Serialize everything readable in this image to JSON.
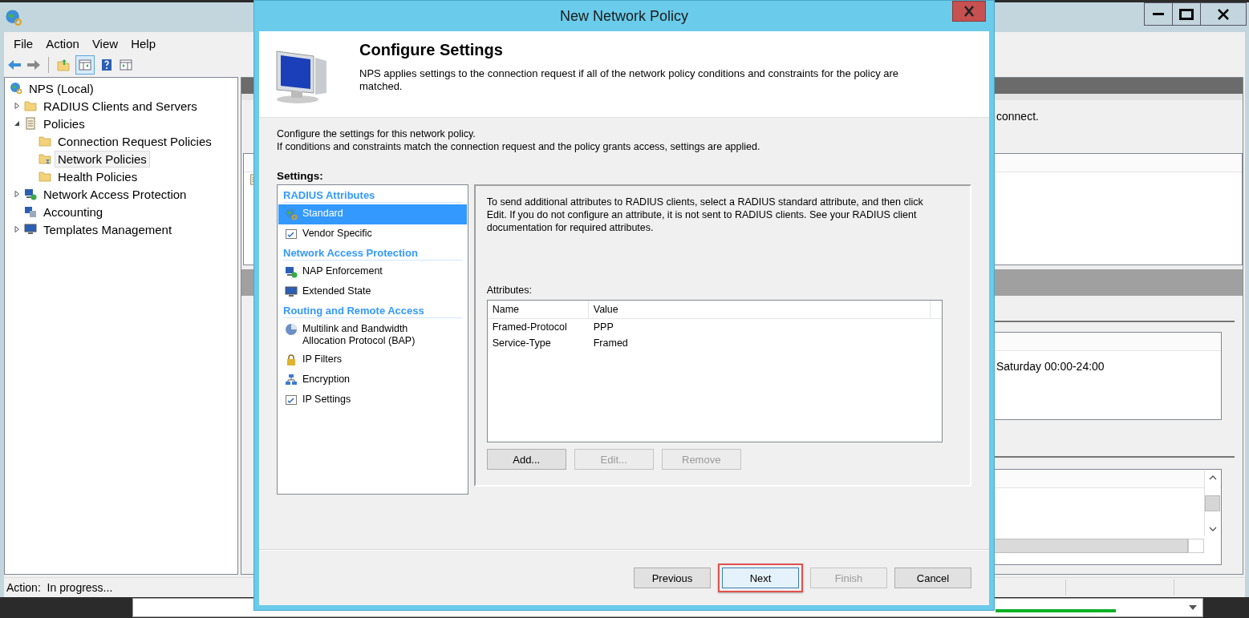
{
  "app": {
    "menu": [
      "File",
      "Action",
      "View",
      "Help"
    ],
    "tree": [
      {
        "label": "NPS (Local)",
        "kind": "globe",
        "selected": false,
        "children": [
          {
            "label": "RADIUS Clients and Servers",
            "kind": "folder",
            "expanded": false,
            "selected": false
          },
          {
            "label": "Policies",
            "kind": "scroll",
            "expanded": true,
            "selected": false,
            "children": [
              {
                "label": "Connection Request Policies",
                "kind": "folder",
                "selected": false
              },
              {
                "label": "Network Policies",
                "kind": "folder-busy",
                "selected": true
              },
              {
                "label": "Health Policies",
                "kind": "folder",
                "selected": false
              }
            ]
          },
          {
            "label": "Network Access Protection",
            "kind": "nap",
            "expanded": false,
            "selected": false
          },
          {
            "label": "Accounting",
            "kind": "accounting",
            "selected": false
          },
          {
            "label": "Templates Management",
            "kind": "monitor",
            "expanded": false,
            "selected": false
          }
        ]
      }
    ],
    "pane": {
      "note": "connect.",
      "schedule": "Saturday 00:00-24:00"
    },
    "status_bar": "Action:  In progress..."
  },
  "dialog": {
    "title": "New Network Policy",
    "heading": "Configure Settings",
    "description": "NPS applies settings to the connection request if all of the network policy conditions and constraints for the policy are matched.",
    "intro": [
      "Configure the settings for this network policy.",
      "If conditions and constraints match the connection request and the policy grants access, settings are applied."
    ],
    "settings_label": "Settings:",
    "settings": [
      {
        "kind": "heading",
        "label": "RADIUS Attributes"
      },
      {
        "kind": "globe",
        "label": "Standard",
        "selected": true
      },
      {
        "kind": "checklist",
        "label": "Vendor Specific",
        "selected": false
      },
      {
        "kind": "heading",
        "label": "Network Access Protection"
      },
      {
        "kind": "nap",
        "label": "NAP Enforcement",
        "selected": false
      },
      {
        "kind": "monitor",
        "label": "Extended State",
        "selected": false
      },
      {
        "kind": "heading",
        "label": "Routing and Remote Access"
      },
      {
        "kind": "pie",
        "label": "Multilink and Bandwidth Allocation Protocol (BAP)",
        "selected": false
      },
      {
        "kind": "lock",
        "label": "IP Filters",
        "selected": false
      },
      {
        "kind": "network",
        "label": "Encryption",
        "selected": false
      },
      {
        "kind": "checklist",
        "label": "IP Settings",
        "selected": false
      }
    ],
    "detail": {
      "text": "To send additional attributes to RADIUS clients, select a RADIUS standard attribute, and then click Edit. If you do not configure an attribute, it is not sent to RADIUS clients. See your RADIUS client documentation for required attributes.",
      "attributes_label": "Attributes:",
      "columns": [
        "Name",
        "Value"
      ],
      "rows": [
        [
          "Framed-Protocol",
          "PPP"
        ],
        [
          "Service-Type",
          "Framed"
        ]
      ],
      "buttons": [
        {
          "label": "Add...",
          "disabled": false
        },
        {
          "label": "Edit...",
          "disabled": true
        },
        {
          "label": "Remove",
          "disabled": true
        }
      ]
    },
    "buttons": [
      {
        "label": "Previous",
        "disabled": false,
        "highlighted": false
      },
      {
        "label": "Next",
        "disabled": false,
        "highlighted": true
      },
      {
        "label": "Finish",
        "disabled": true,
        "highlighted": false
      },
      {
        "label": "Cancel",
        "disabled": false,
        "highlighted": false
      }
    ]
  }
}
